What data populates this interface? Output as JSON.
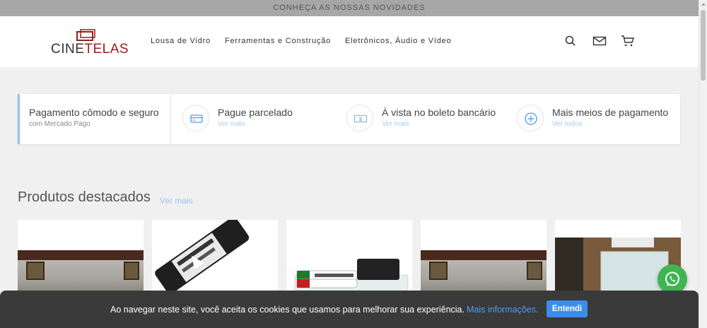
{
  "announcement": "CONHEÇA AS NOSSAS NOVIDADES",
  "logo": {
    "part1": "CINE",
    "part2": "TELAS"
  },
  "nav": [
    {
      "label": "Lousa de Vidro"
    },
    {
      "label": "Ferramentas e Construção"
    },
    {
      "label": "Eletrônicos, Áudio e Vídeo"
    }
  ],
  "header_icons": [
    "search-icon",
    "mail-icon",
    "cart-icon"
  ],
  "payments": {
    "first": {
      "title": "Pagamento cômodo e seguro",
      "subtitle": "com Mercado Pago"
    },
    "items": [
      {
        "title": "Pague parcelado",
        "link": "Ver mais",
        "icon": "credit-card-icon"
      },
      {
        "title": "À vista no boleto bancário",
        "link": "Ver mais",
        "icon": "cash-icon"
      },
      {
        "title": "Mais meios de pagamento",
        "link": "Ver todos",
        "icon": "plus-circle-icon"
      }
    ]
  },
  "featured": {
    "title": "Produtos destacados",
    "more": "Ver mais"
  },
  "cookie": {
    "message": "Ao navegar neste site, você aceita os cookies que usamos para melhorar sua experiência.",
    "link": "Mais informações.",
    "button": "Entendi"
  },
  "colors": {
    "accent": "#3b8ded",
    "brand_red": "#9b1b1b",
    "whatsapp": "#3eb551",
    "link_light": "#9cc5ec"
  }
}
